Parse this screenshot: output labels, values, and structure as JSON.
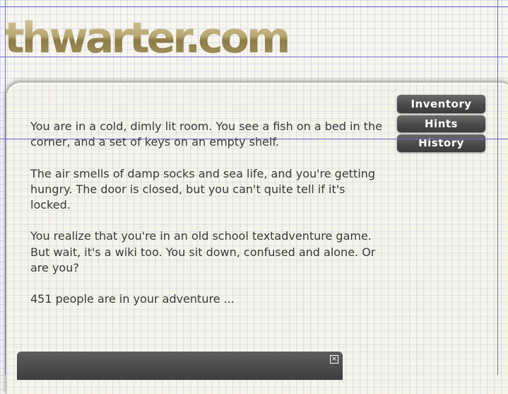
{
  "header": {
    "logo_text": "thwarter.com"
  },
  "story": {
    "paragraphs": [
      "You are in a cold, dimly lit room.  You see a fish on a bed in the corner, and a set of keys on an empty shelf.",
      "The air smells of damp socks and sea life, and you're getting hungry.  The door is closed, but you can't quite tell if it's locked.",
      "You realize that you're in an old school textadventure game. But wait, it's a wiki too.  You sit down, confused and alone. Or are you?",
      "451 people are in your adventure ..."
    ]
  },
  "menu": {
    "items": [
      {
        "label": "Inventory"
      },
      {
        "label": "Hints"
      },
      {
        "label": "History"
      }
    ]
  },
  "chat_bar": {
    "close_glyph": "×",
    "close_icon": "close-icon"
  },
  "colors": {
    "background": "#f7f6ef",
    "grid": "#8c8cc8",
    "guide_lines": "#6a6ad8",
    "logo_gold": "#a99a63",
    "button_dark": "#4a4a4a",
    "text": "#3a3a3a"
  }
}
